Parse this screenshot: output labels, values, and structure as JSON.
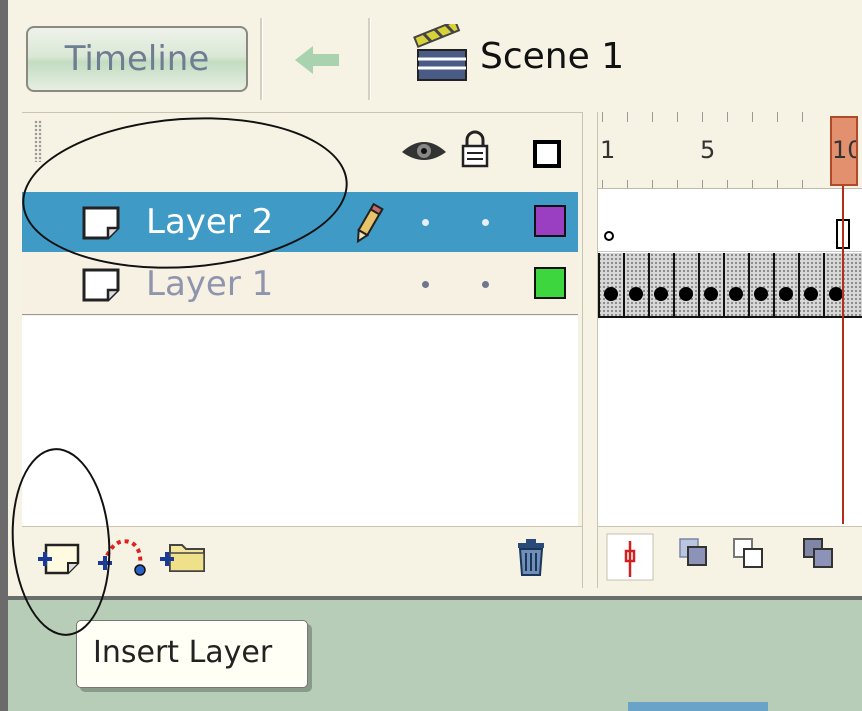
{
  "toolbar": {
    "timeline_label": "Timeline",
    "scene_label": "Scene 1",
    "back_icon": "back-arrow-icon",
    "scene_icon": "clapperboard-icon"
  },
  "layers_header": {
    "icons": [
      "eye-icon",
      "lock-icon",
      "outline-icon"
    ]
  },
  "layers": [
    {
      "name": "Layer 2",
      "selected": true,
      "color": "#9b3fc2",
      "editing_icon": "pencil-icon"
    },
    {
      "name": "Layer 1",
      "selected": false,
      "color": "#3ed63e"
    }
  ],
  "ruler": {
    "labels": [
      "1",
      "5",
      "10"
    ],
    "current_frame": "10"
  },
  "bottom_toolbar": {
    "layer_buttons": [
      "insert-layer-icon",
      "add-motion-guide-icon",
      "insert-layer-folder-icon",
      "delete-layer-icon"
    ],
    "frame_buttons": [
      "center-frame-icon",
      "onion-skin-icon",
      "onion-skin-outlines-icon",
      "edit-multiple-frames-icon"
    ]
  },
  "tooltip": {
    "text": "Insert Layer"
  },
  "colors": {
    "selected_row": "#3f9ac5",
    "panel_bg": "#f6f3e4",
    "playhead": "#b52e1a"
  }
}
